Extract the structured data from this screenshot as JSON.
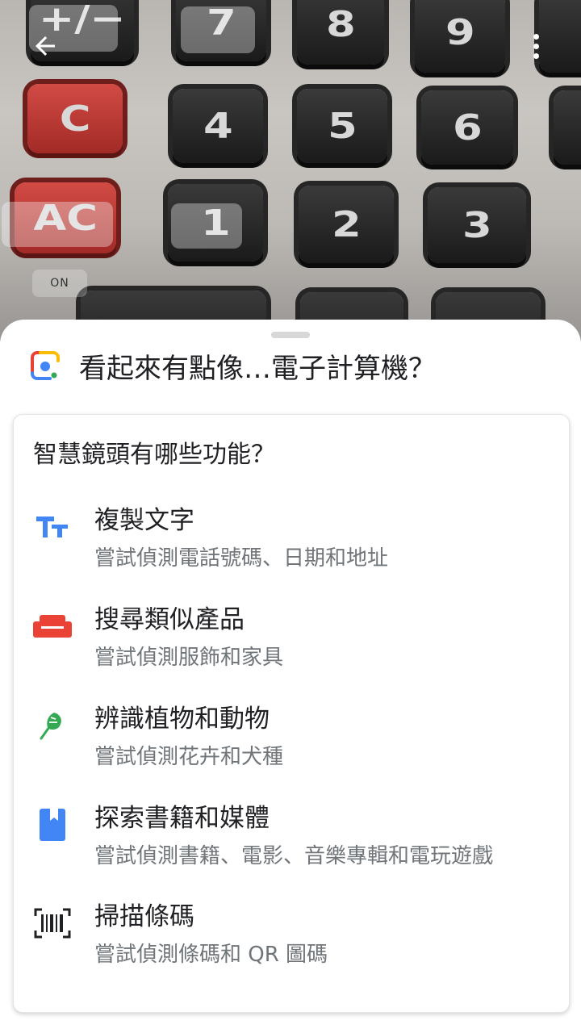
{
  "camera": {
    "keys": [
      "+/−",
      "7",
      "8",
      "9",
      "C",
      "4",
      "5",
      "6",
      "AC",
      "1",
      "2",
      "3"
    ],
    "on_label": "ON"
  },
  "toolbar": {
    "back_icon": "arrow-back-icon",
    "more_icon": "more-vert-icon"
  },
  "sheet": {
    "title": "看起來有點像…電子計算機？",
    "logo_icon": "google-lens-icon"
  },
  "card": {
    "title": "智慧鏡頭有哪些功能？",
    "features": [
      {
        "title": "複製文字",
        "description": "嘗試偵測電話號碼、日期和地址",
        "icon": "text-icon",
        "color": "#4285F4"
      },
      {
        "title": "搜尋類似產品",
        "description": "嘗試偵測服飾和家具",
        "icon": "sofa-icon",
        "color": "#EA4335"
      },
      {
        "title": "辨識植物和動物",
        "description": "嘗試偵測花卉和犬種",
        "icon": "leaf-icon",
        "color": "#34A853"
      },
      {
        "title": "探索書籍和媒體",
        "description": "嘗試偵測書籍、電影、音樂專輯和電玩遊戲",
        "icon": "book-icon",
        "color": "#4285F4"
      },
      {
        "title": "掃描條碼",
        "description": "嘗試偵測條碼和 QR 圖碼",
        "icon": "barcode-icon",
        "color": "#202124"
      }
    ]
  }
}
